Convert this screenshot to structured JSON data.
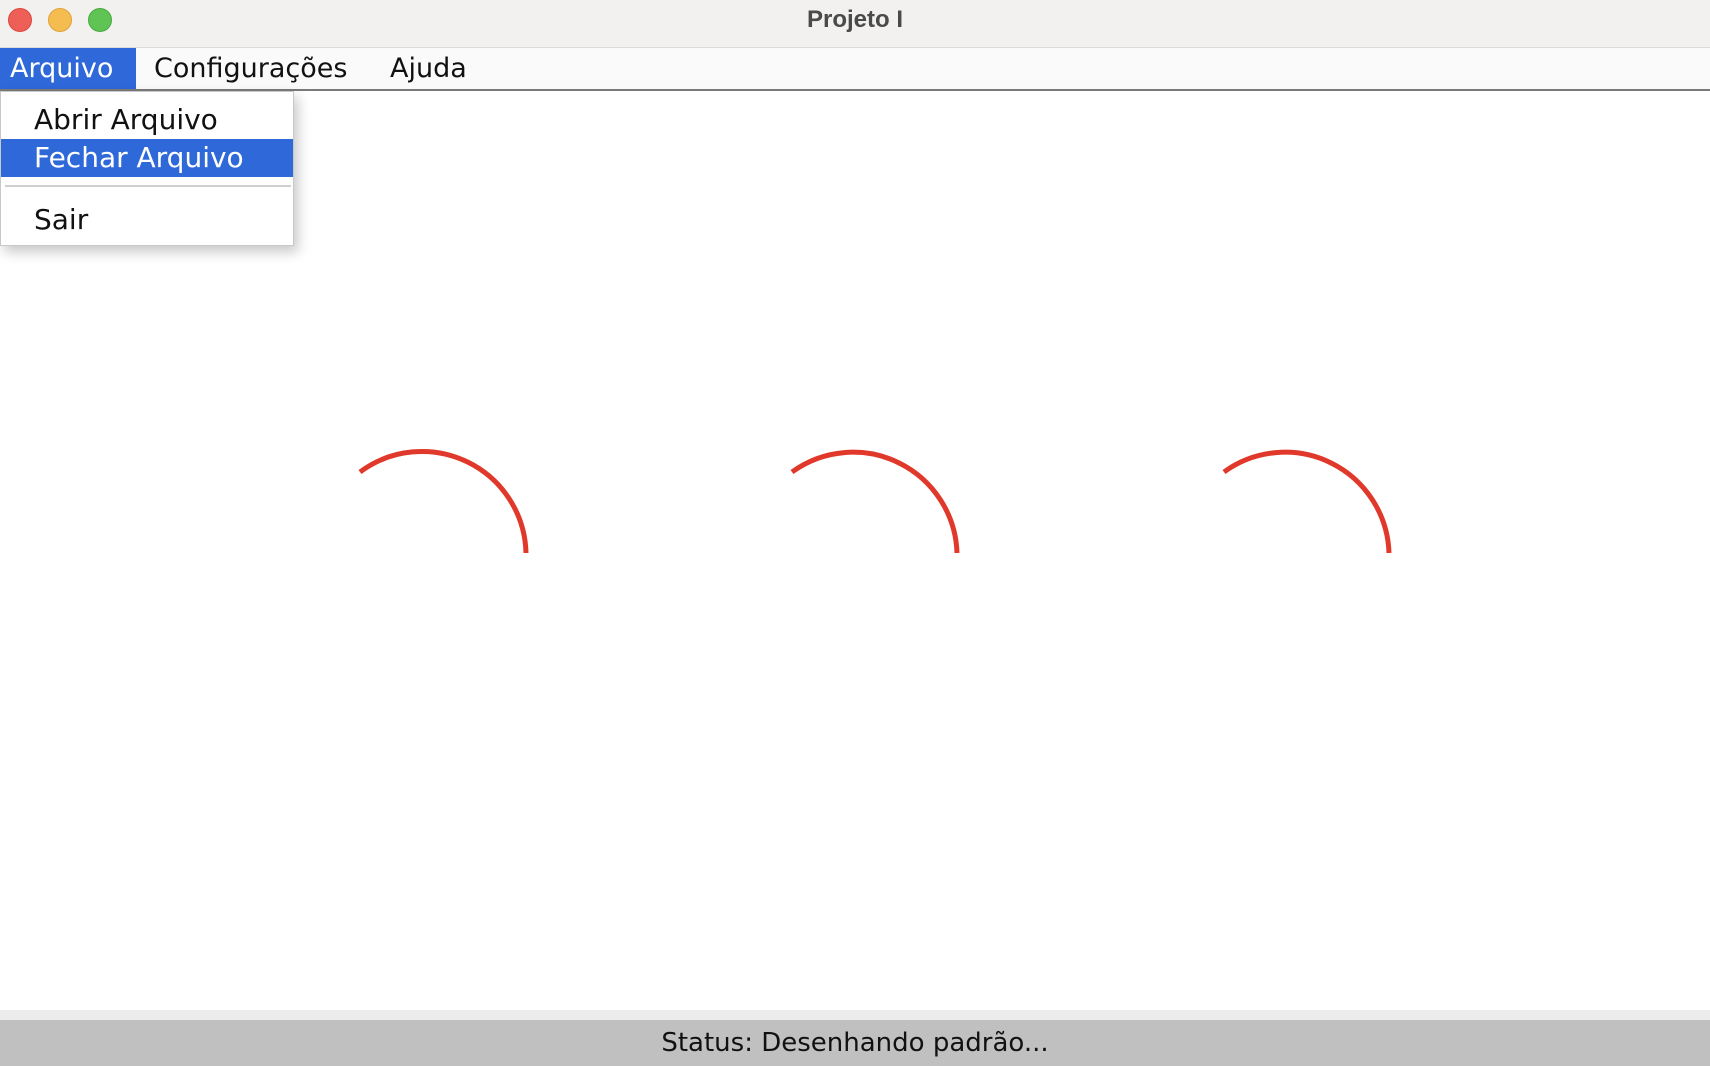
{
  "window": {
    "title": "Projeto I"
  },
  "menubar": {
    "items": [
      {
        "label": "Arquivo",
        "active": true
      },
      {
        "label": "Configurações",
        "active": false
      },
      {
        "label": "Ajuda",
        "active": false
      }
    ]
  },
  "file_menu": {
    "items": [
      {
        "label": "Abrir Arquivo",
        "selected": false
      },
      {
        "label": "Fechar Arquivo",
        "selected": true
      },
      {
        "label": "Sair",
        "selected": false
      }
    ]
  },
  "canvas": {
    "arc_count": 3,
    "arc_color": "#e0392b"
  },
  "statusbar": {
    "text": "Status: Desenhando padrão..."
  },
  "colors": {
    "accent": "#2e68d9",
    "arc": "#e0392b",
    "statusbar": "#c0c0c0"
  }
}
